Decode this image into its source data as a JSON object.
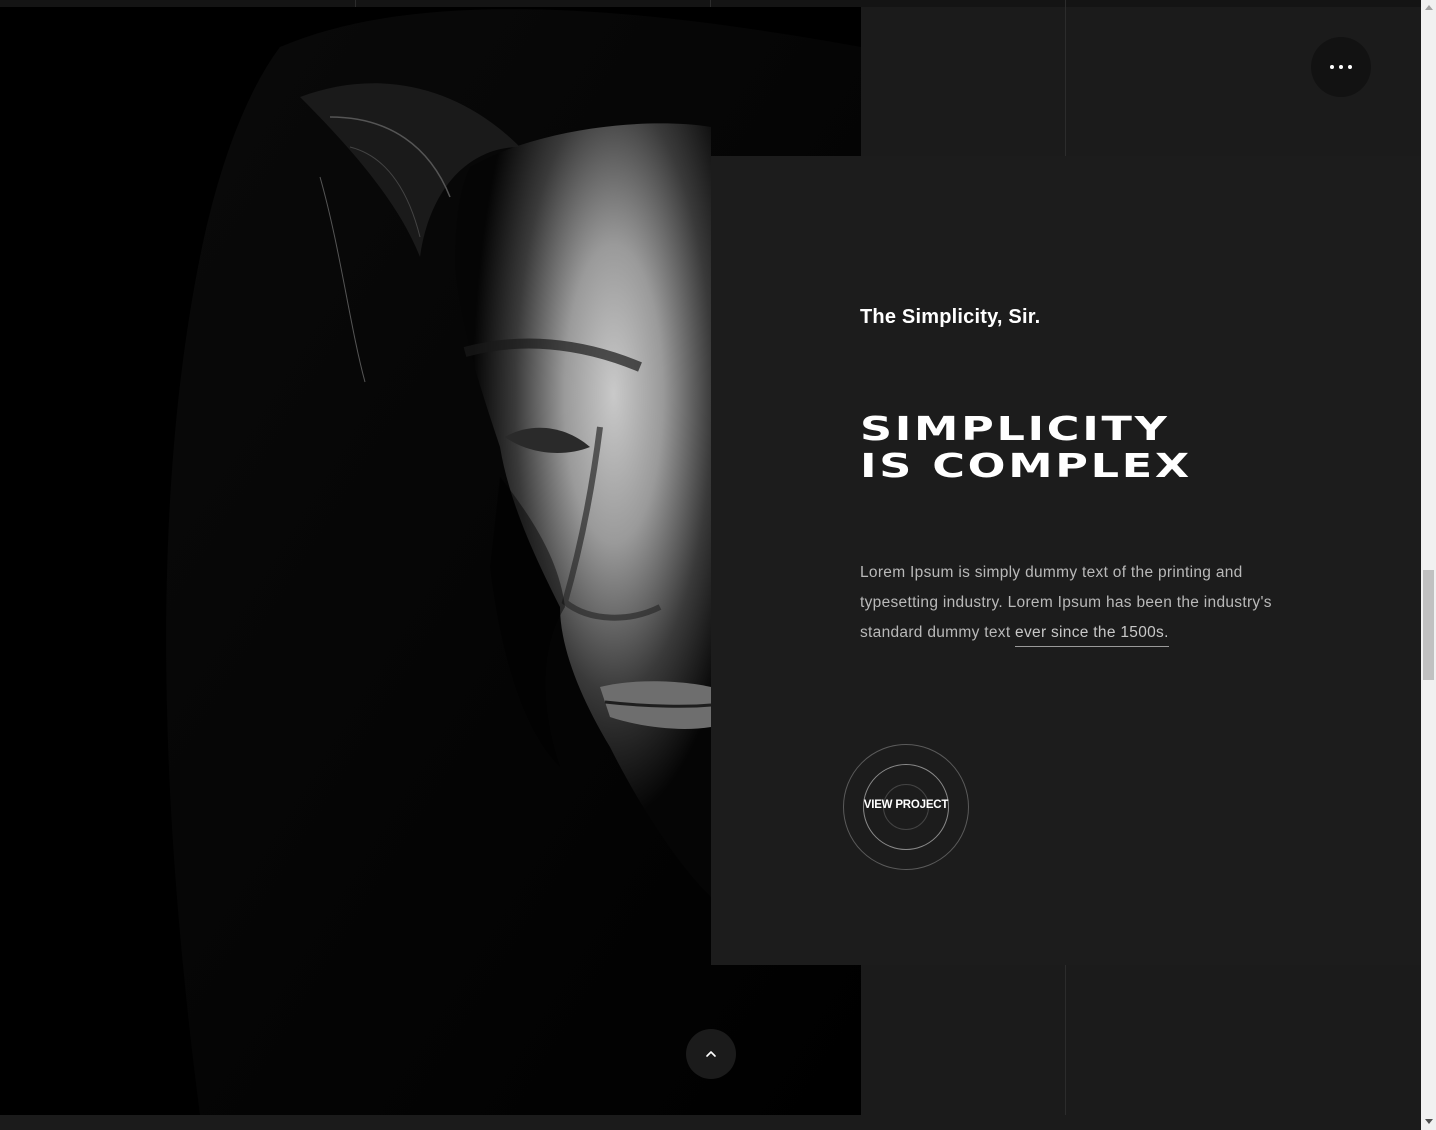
{
  "hero": {
    "image_alt": "Black and white portrait of a face half in shadow",
    "image_icon": "portrait-photo"
  },
  "content": {
    "subtitle": "The Simplicity, Sir.",
    "headline_line1": "SIMPLICITY",
    "headline_line2": "IS COMPLEX",
    "body_text": "Lorem Ipsum is simply dummy text of the printing and typesetting industry. Lorem Ipsum has been the industry's standard dummy text ",
    "body_link": "ever since the 1500s."
  },
  "cta": {
    "label": "VIEW PROJECT"
  },
  "menu": {
    "icon": "more-horizontal-icon"
  },
  "scroll_top": {
    "icon": "chevron-up-icon"
  },
  "colors": {
    "background": "#1b1b1b",
    "panel": "#1c1c1c",
    "text_primary": "#ffffff",
    "text_secondary": "#b9b9b9"
  }
}
